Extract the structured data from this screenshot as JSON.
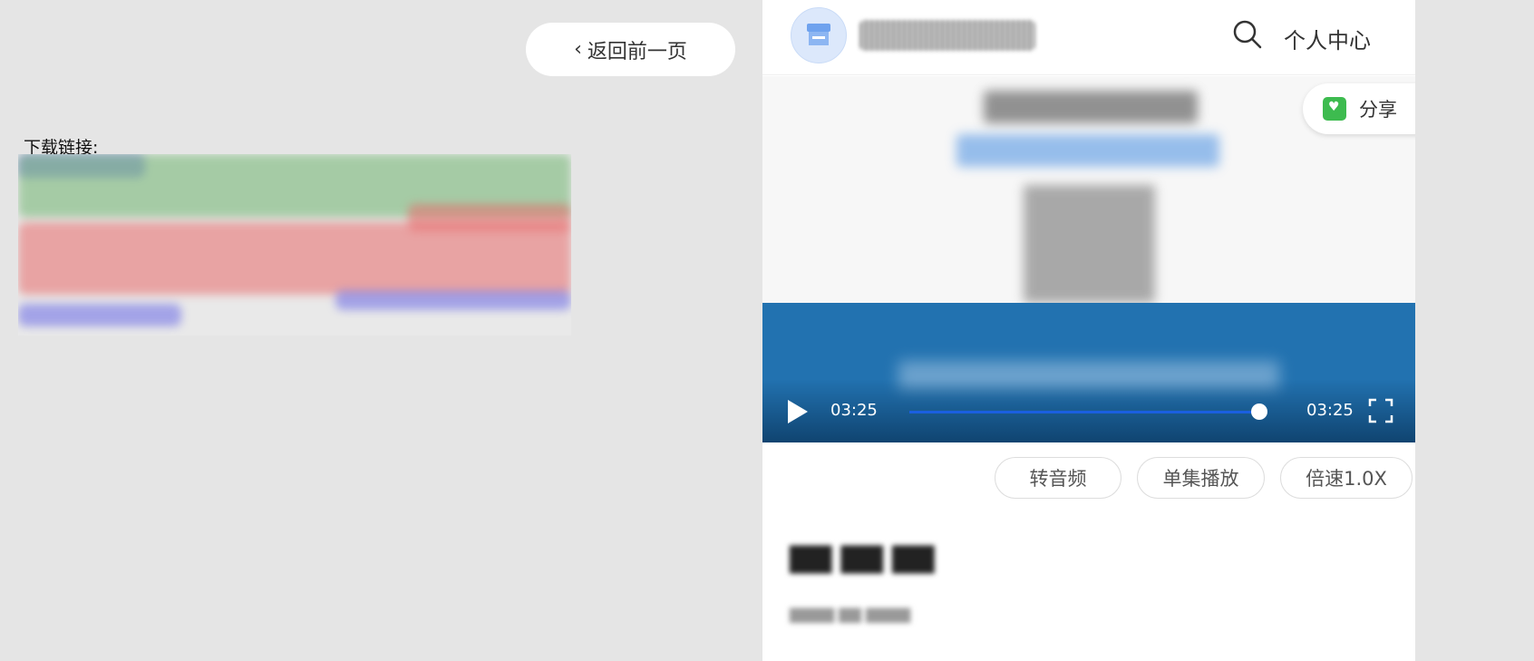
{
  "left": {
    "back_label": "返回前一页",
    "download_label": "下载链接:"
  },
  "header": {
    "personal_center": "个人中心"
  },
  "share": {
    "label": "分享"
  },
  "player": {
    "current_time": "03:25",
    "duration": "03:25",
    "progress": 1.0
  },
  "actions": [
    "转音频",
    "单集播放",
    "倍速1.0X"
  ],
  "colors": {
    "video_bg": "#2272b0",
    "progress": "#1a5fe0",
    "share_green": "#3dbb4f",
    "page_bg": "#e5e5e5"
  },
  "icons": [
    "chevron-left-icon",
    "store-icon",
    "search-icon",
    "share-icon",
    "play-icon",
    "fullscreen-icon"
  ]
}
